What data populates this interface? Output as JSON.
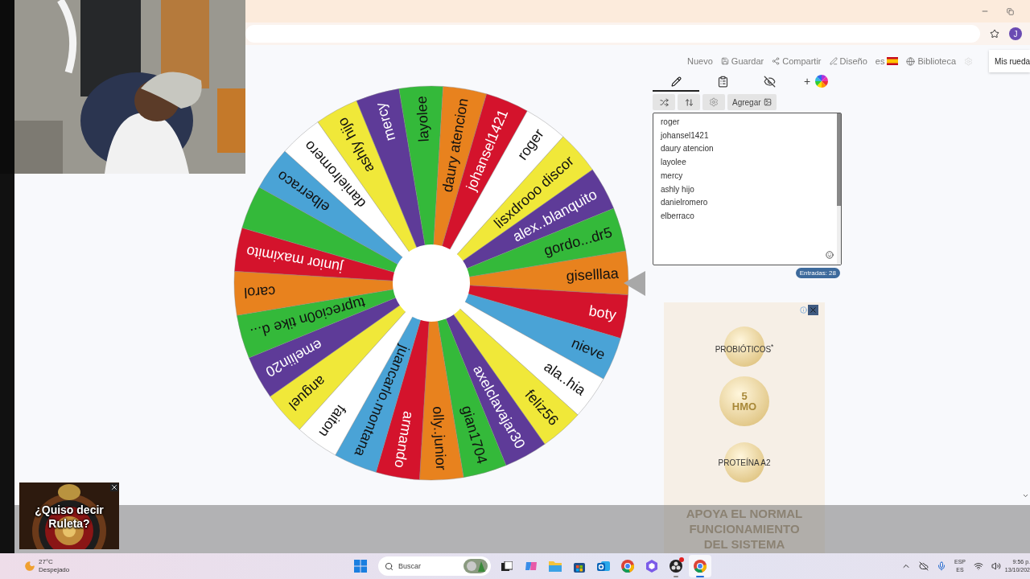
{
  "browser": {
    "avatar": "J"
  },
  "toolbar": {
    "items": [
      {
        "kind": "plain",
        "label": "Nuevo"
      },
      {
        "kind": "save",
        "label": "Guardar"
      },
      {
        "kind": "share",
        "label": "Compartir"
      },
      {
        "kind": "design",
        "label": "Diseño"
      },
      {
        "kind": "language",
        "label": "es"
      },
      {
        "kind": "library",
        "label": "Biblioteca"
      },
      {
        "kind": "settings"
      }
    ],
    "my_wheels": "Mis rueda"
  },
  "wheel": {
    "segments": [
      {
        "label": "giselllaa",
        "color": "#e8821e"
      },
      {
        "label": "boty",
        "color": "#d4132c"
      },
      {
        "label": "nieve",
        "color": "#4aa3d6"
      },
      {
        "label": "ala..hia",
        "color": "#ffffff"
      },
      {
        "label": "feliz56",
        "color": "#f0e839"
      },
      {
        "label": "axelclavajar30",
        "color": "#5e3b98"
      },
      {
        "label": "gian1704",
        "color": "#34b93a"
      },
      {
        "label": "olly..junior",
        "color": "#e8821e"
      },
      {
        "label": "armando",
        "color": "#d4132c"
      },
      {
        "label": "juancarlo.montana",
        "color": "#4aa3d6"
      },
      {
        "label": "faiton",
        "color": "#ffffff"
      },
      {
        "label": "anguel",
        "color": "#f0e839"
      },
      {
        "label": "emeliin20",
        "color": "#5e3b98"
      },
      {
        "label": "tuprecio0n tike d...",
        "color": "#34b93a"
      },
      {
        "label": "carol",
        "color": "#e8821e"
      },
      {
        "label": "junior maximito",
        "color": "#d4132c"
      },
      {
        "color": "#34b93a"
      },
      {
        "label": "elberraco",
        "color": "#4aa3d6"
      },
      {
        "label": "danielromero",
        "color": "#ffffff"
      },
      {
        "label": "ashly hijo",
        "color": "#f0e839"
      },
      {
        "label": "mercy",
        "color": "#5e3b98"
      },
      {
        "label": "layolee",
        "color": "#34b93a"
      },
      {
        "label": "daury atencion",
        "color": "#e8821e"
      },
      {
        "label": "johansel1421",
        "color": "#d4132c"
      },
      {
        "label": "roger",
        "color": "#ffffff"
      },
      {
        "label": "lisxdrooo discor",
        "color": "#f0e839"
      },
      {
        "label": "alex..blanquito",
        "color": "#5e3b98"
      },
      {
        "label": "gordo...dr5",
        "color": "#34b93a"
      }
    ]
  },
  "editor": {
    "tabs": [
      {
        "kind": "edit",
        "selected": true
      },
      {
        "kind": "results",
        "selected": false
      },
      {
        "kind": "hidden",
        "selected": false
      },
      {
        "kind": "colors",
        "label": "+",
        "selected": false
      }
    ],
    "tools": [
      {
        "kind": "shuffle"
      },
      {
        "kind": "sort"
      },
      {
        "kind": "settings"
      },
      {
        "kind": "add_image",
        "label": "Agregar"
      }
    ],
    "entries": [
      "roger",
      "johansel1421",
      "daury atencion",
      "layolee",
      "mercy",
      "ashly hijo",
      "danielromero",
      "elberraco"
    ],
    "count": "Entradas: 28"
  },
  "ad": {
    "items": [
      "PROBIÓTICOS$^{*}$",
      "5",
      "HMO",
      "PROTEÍNA A2"
    ],
    "footer": "APOYA EL NORMAL FUNCIONAMIENTO DEL SISTEMA"
  },
  "video_suggestion": {
    "caption": "¿Quiso decir Ruleta?"
  },
  "taskbar": {
    "weather": {
      "temp": "27°C",
      "condition": "Despejado"
    },
    "search": {
      "placeholder": "Buscar"
    },
    "apps": [
      {
        "kind": "copilot",
        "running": false,
        "alert": false,
        "selected": false
      },
      {
        "kind": "folder",
        "running": false,
        "alert": false,
        "selected": false
      },
      {
        "kind": "store",
        "running": false,
        "alert": false,
        "selected": false
      },
      {
        "kind": "mail",
        "running": false,
        "alert": false,
        "selected": false
      },
      {
        "kind": "browser",
        "running": false,
        "alert": false,
        "selected": false
      },
      {
        "kind": "hexagon",
        "running": false,
        "alert": false,
        "selected": false
      },
      {
        "kind": "recorder",
        "running": true,
        "alert": true,
        "selected": false
      },
      {
        "kind": "browser",
        "running": true,
        "alert": false,
        "selected": true
      }
    ],
    "language": [
      "ESP",
      "ES"
    ],
    "time": "9:56 p.",
    "date": "13/10/202"
  }
}
